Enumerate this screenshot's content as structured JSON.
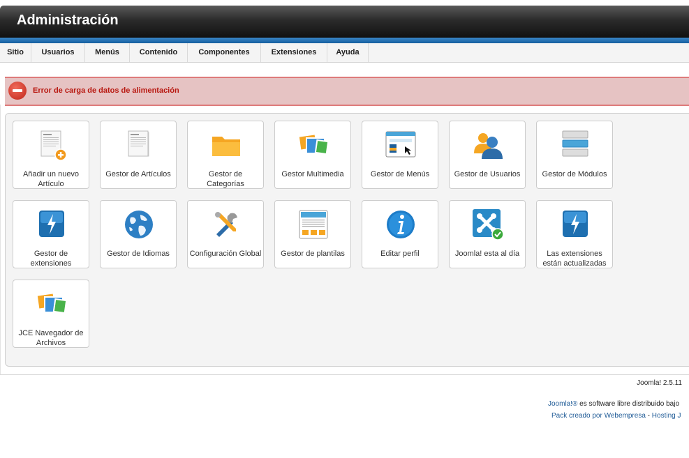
{
  "header": {
    "title": "Administración"
  },
  "menu": [
    "Sitio",
    "Usuarios",
    "Menús",
    "Contenido",
    "Componentes",
    "Extensiones",
    "Ayuda"
  ],
  "alert": {
    "message": "Error de carga de datos de alimentación"
  },
  "tiles": [
    {
      "label": "Añadir un nuevo Artículo",
      "icon": "add-article-icon"
    },
    {
      "label": "Gestor de Artículos",
      "icon": "article-icon"
    },
    {
      "label": "Gestor de Categorías",
      "icon": "folder-icon"
    },
    {
      "label": "Gestor Multimedia",
      "icon": "media-icon"
    },
    {
      "label": "Gestor de Menús",
      "icon": "menu-icon"
    },
    {
      "label": "Gestor de Usuarios",
      "icon": "users-icon"
    },
    {
      "label": "Gestor de Módulos",
      "icon": "modules-icon"
    },
    {
      "label": "Gestor de extensiones",
      "icon": "extensions-icon"
    },
    {
      "label": "Gestor de Idiomas",
      "icon": "globe-icon"
    },
    {
      "label": "Configuración Global",
      "icon": "tools-icon"
    },
    {
      "label": "Gestor de plantilas",
      "icon": "template-icon"
    },
    {
      "label": "Editar perfil",
      "icon": "info-icon"
    },
    {
      "label": "Joomla! esta al día",
      "icon": "joomla-check-icon"
    },
    {
      "label": "Las extensiones están actualizadas",
      "icon": "extensions-updated-icon"
    },
    {
      "label": "JCE Navegador de Archivos",
      "icon": "file-browser-icon"
    }
  ],
  "footer": {
    "version": "Joomla! 2.5.11",
    "joomla_link": "Joomla!®",
    "license_text": " es software libre distribuido bajo",
    "pack_text": "Pack creado por Webempresa",
    "separator": " - ",
    "hosting_link": "Hosting J"
  }
}
